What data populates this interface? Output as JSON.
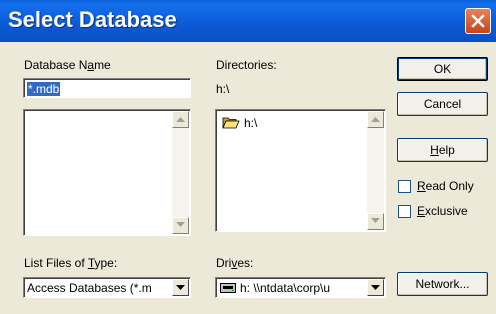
{
  "window": {
    "title": "Select Database"
  },
  "database_name": {
    "label_pre": "Database N",
    "label_ul": "a",
    "label_post": "me",
    "value": "*.mdb"
  },
  "directories": {
    "label": "Directories:",
    "current_path": "h:\\",
    "items": [
      {
        "label": "h:\\",
        "icon": "open-folder-icon"
      }
    ]
  },
  "buttons": {
    "ok": "OK",
    "cancel": "Cancel",
    "help_ul": "H",
    "help_rest": "elp",
    "network": "Network..."
  },
  "options": {
    "read_only_ul": "R",
    "read_only_rest": "ead Only",
    "read_only_checked": false,
    "exclusive_ul": "E",
    "exclusive_rest": "xclusive",
    "exclusive_checked": false
  },
  "file_type": {
    "label_pre": "List Files of ",
    "label_ul": "T",
    "label_post": "ype:",
    "selected": "Access Databases (*.m"
  },
  "drives": {
    "label_pre": "Dri",
    "label_ul": "v",
    "label_post": "es:",
    "selected": "h: \\\\ntdata\\corp\\u",
    "icon": "network-drive-icon"
  },
  "colors": {
    "titlebar": "#0a5fd6",
    "selection": "#316ac5",
    "face": "#ece9d8"
  }
}
